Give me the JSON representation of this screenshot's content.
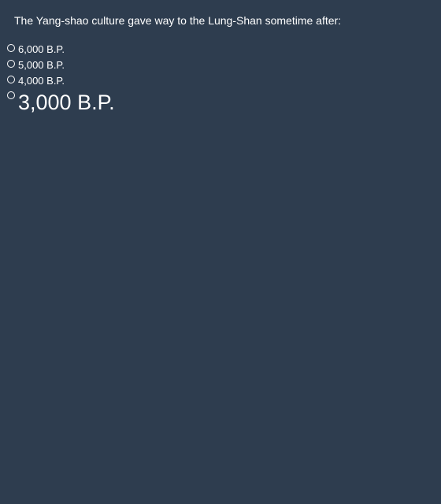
{
  "question": {
    "text": "The Yang-shao culture gave way to the Lung-Shan sometime after:"
  },
  "options": [
    {
      "label": "6,000 B.P."
    },
    {
      "label": "5,000 B.P."
    },
    {
      "label": "4,000 B.P."
    },
    {
      "label": "3,000 B.P."
    }
  ],
  "colors": {
    "background": "#2e3d4f",
    "text": "#ffffff"
  }
}
